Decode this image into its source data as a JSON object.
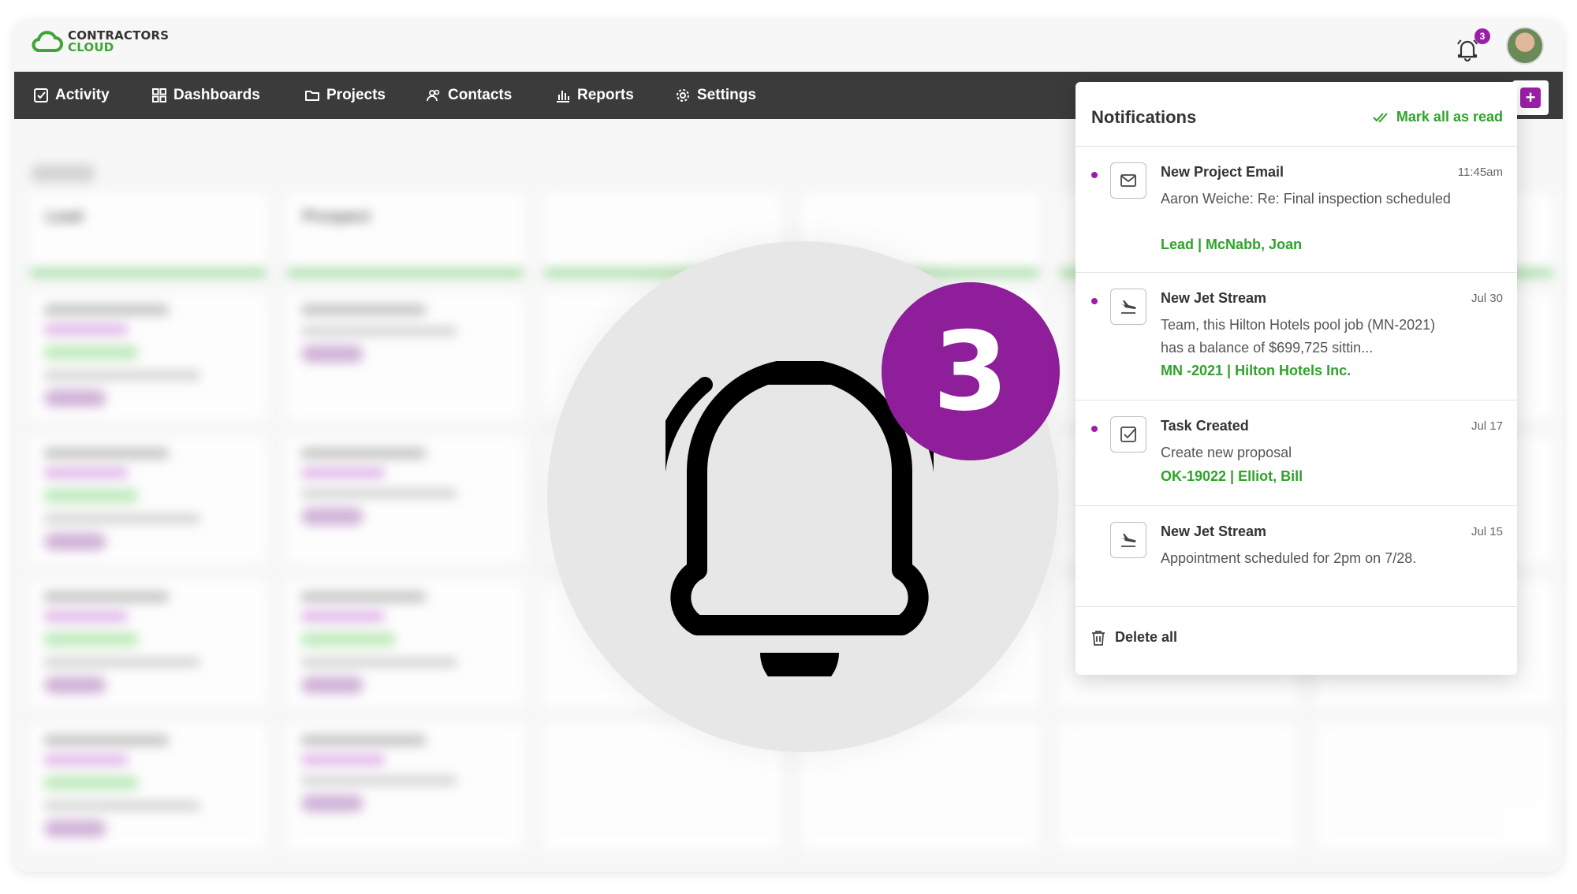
{
  "app": {
    "logo_line1": "CONTRACTORS",
    "logo_line2": "CLOUD",
    "brand_green": "#3fa535",
    "accent_purple": "#9b1fa6",
    "notification_count": "3"
  },
  "nav": {
    "items": [
      {
        "label": "Activity",
        "icon": "checkbox-icon"
      },
      {
        "label": "Dashboards",
        "icon": "grid-icon"
      },
      {
        "label": "Projects",
        "icon": "folder-icon"
      },
      {
        "label": "Contacts",
        "icon": "people-icon"
      },
      {
        "label": "Reports",
        "icon": "bar-chart-icon"
      },
      {
        "label": "Settings",
        "icon": "gear-icon"
      }
    ]
  },
  "board": {
    "columns": [
      {
        "title": "Lead"
      },
      {
        "title": "Prospect"
      }
    ]
  },
  "hero": {
    "badge": "3"
  },
  "notifications": {
    "title": "Notifications",
    "mark_all_label": "Mark all as read",
    "items": [
      {
        "title": "New Project Email",
        "time": "11:45am",
        "body": "Aaron Weiche: Re: Final inspection scheduled",
        "link": "Lead | McNabb, Joan",
        "unread": true,
        "icon": "mail-icon"
      },
      {
        "title": "New Jet Stream",
        "time": "Jul 30",
        "body": "Team, this Hilton Hotels pool job (MN-2021) has a balance of $699,725 sittin...",
        "link": "MN -2021 | Hilton Hotels Inc.",
        "unread": true,
        "icon": "plane-icon"
      },
      {
        "title": "Task Created",
        "time": "Jul 17",
        "body": "Create new proposal",
        "link": "OK-19022 | Elliot, Bill",
        "unread": true,
        "icon": "task-check-icon"
      },
      {
        "title": "New Jet Stream",
        "time": "Jul 15",
        "body": "Appointment scheduled for 2pm on 7/28.",
        "link": "",
        "unread": false,
        "icon": "plane-icon"
      }
    ],
    "delete_all_label": "Delete all"
  }
}
